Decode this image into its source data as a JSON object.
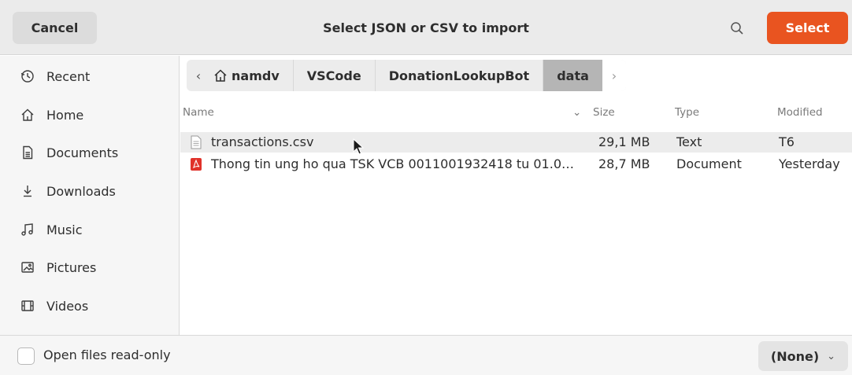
{
  "dialog": {
    "title": "Select JSON or CSV to import",
    "cancel_label": "Cancel",
    "select_label": "Select",
    "search_icon": "search-icon",
    "accent_color": "#e95420"
  },
  "sidebar": {
    "items": [
      {
        "label": "Recent",
        "icon": "clock-icon"
      },
      {
        "label": "Home",
        "icon": "home-icon"
      },
      {
        "label": "Documents",
        "icon": "document-icon"
      },
      {
        "label": "Downloads",
        "icon": "download-icon"
      },
      {
        "label": "Music",
        "icon": "music-icon"
      },
      {
        "label": "Pictures",
        "icon": "picture-icon"
      },
      {
        "label": "Videos",
        "icon": "video-icon"
      }
    ]
  },
  "pathbar": {
    "crumbs": [
      "namdv",
      "VSCode",
      "DonationLookupBot",
      "data"
    ],
    "back_glyph": "‹",
    "forward_glyph": "›"
  },
  "columns": {
    "name": "Name",
    "size": "Size",
    "type": "Type",
    "modified": "Modified"
  },
  "files": [
    {
      "name": "transactions.csv",
      "size": "29,1 MB",
      "type": "Text",
      "modified": "T6",
      "icon": "text-file-icon"
    },
    {
      "name": "Thong tin ung ho qua TSK VCB 0011001932418 tu 01.0…",
      "size": "28,7 MB",
      "type": "Document",
      "modified": "Yesterday",
      "icon": "pdf-file-icon"
    }
  ],
  "footer": {
    "readonly_label": "Open files read-only",
    "readonly_checked": false,
    "filter_value": "(None)"
  }
}
